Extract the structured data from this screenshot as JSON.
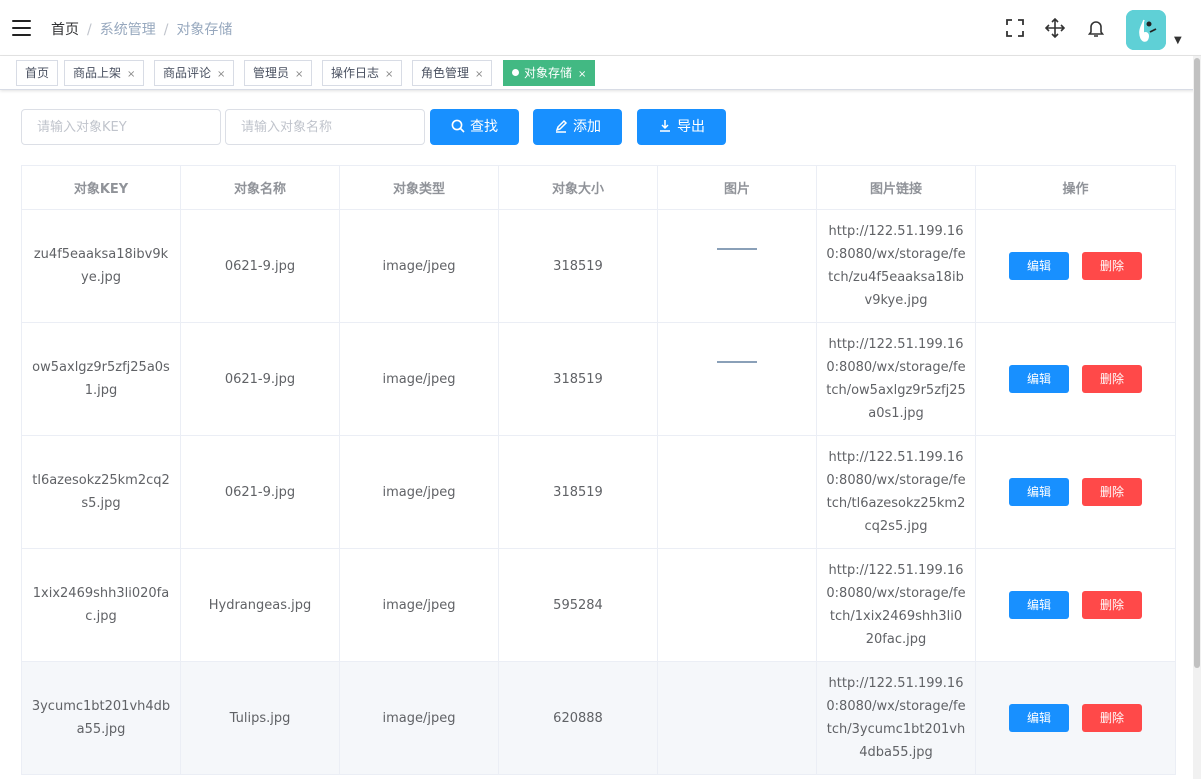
{
  "breadcrumb": {
    "home": "首页",
    "section": "系统管理",
    "current": "对象存储"
  },
  "tags": [
    {
      "label": "首页",
      "closable": false,
      "active": false
    },
    {
      "label": "商品上架",
      "closable": true,
      "active": false
    },
    {
      "label": "商品评论",
      "closable": true,
      "active": false
    },
    {
      "label": "管理员",
      "closable": true,
      "active": false
    },
    {
      "label": "操作日志",
      "closable": true,
      "active": false
    },
    {
      "label": "角色管理",
      "closable": true,
      "active": false
    },
    {
      "label": "对象存储",
      "closable": true,
      "active": true
    }
  ],
  "filters": {
    "key_placeholder": "请输入对象KEY",
    "name_placeholder": "请输入对象名称",
    "search_label": "查找",
    "add_label": "添加",
    "export_label": "导出"
  },
  "table": {
    "headers": [
      "对象KEY",
      "对象名称",
      "对象类型",
      "对象大小",
      "图片",
      "图片链接",
      "操作"
    ],
    "rows": [
      {
        "key": "zu4f5eaaksa18ibv9kye.jpg",
        "name": "0621-9.jpg",
        "type": "image/jpeg",
        "size": "318519",
        "has_thumb": true,
        "url": "http://122.51.199.160:8080/wx/storage/fetch/zu4f5eaaksa18ibv9kye.jpg"
      },
      {
        "key": "ow5axlgz9r5zfj25a0s1.jpg",
        "name": "0621-9.jpg",
        "type": "image/jpeg",
        "size": "318519",
        "has_thumb": true,
        "url": "http://122.51.199.160:8080/wx/storage/fetch/ow5axlgz9r5zfj25a0s1.jpg"
      },
      {
        "key": "tl6azesokz25km2cq2s5.jpg",
        "name": "0621-9.jpg",
        "type": "image/jpeg",
        "size": "318519",
        "has_thumb": false,
        "url": "http://122.51.199.160:8080/wx/storage/fetch/tl6azesokz25km2cq2s5.jpg"
      },
      {
        "key": "1xix2469shh3li020fac.jpg",
        "name": "Hydrangeas.jpg",
        "type": "image/jpeg",
        "size": "595284",
        "has_thumb": false,
        "url": "http://122.51.199.160:8080/wx/storage/fetch/1xix2469shh3li020fac.jpg"
      },
      {
        "key": "3ycumc1bt201vh4dba55.jpg",
        "name": "Tulips.jpg",
        "type": "image/jpeg",
        "size": "620888",
        "has_thumb": false,
        "url": "http://122.51.199.160:8080/wx/storage/fetch/3ycumc1bt201vh4dba55.jpg"
      }
    ],
    "edit_label": "编辑",
    "delete_label": "删除"
  },
  "colors": {
    "primary": "#1890ff",
    "danger": "#ff4949",
    "tag_active": "#42b983",
    "avatar_bg": "#5fd0d6"
  },
  "icons": [
    "hamburger-icon",
    "fullscreen-icon",
    "size-icon",
    "bell-icon",
    "search-icon",
    "edit-icon",
    "download-icon",
    "caret-down-icon"
  ]
}
